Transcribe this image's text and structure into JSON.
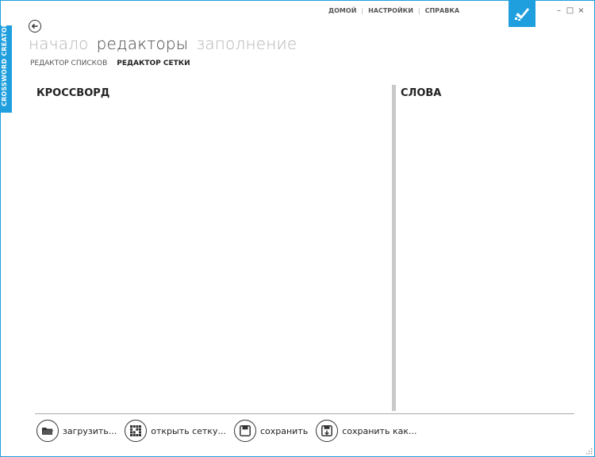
{
  "app": {
    "side_title": "CROSSWORD CREATOR",
    "accent": "#1f9fde"
  },
  "top_links": [
    {
      "label": "ДОМОЙ"
    },
    {
      "label": "НАСТРОЙКИ"
    },
    {
      "label": "СПРАВКА"
    }
  ],
  "window_controls": {
    "minimize": "–",
    "maximize": "□",
    "close": "×"
  },
  "nav": {
    "main": [
      {
        "label": "начало",
        "active": false
      },
      {
        "label": "редакторы",
        "active": true
      },
      {
        "label": "заполнение",
        "active": false
      }
    ],
    "sub": [
      {
        "label": "РЕДАКТОР СПИСКОВ",
        "active": false
      },
      {
        "label": "РЕДАКТОР СЕТКИ",
        "active": true
      }
    ]
  },
  "panels": {
    "left_title": "КРОССВОРД",
    "right_title": "СЛОВА"
  },
  "toolbar": [
    {
      "label": "загрузить...",
      "icon": "folder-icon"
    },
    {
      "label": "открыть сетку...",
      "icon": "grid-icon"
    },
    {
      "label": "сохранить",
      "icon": "floppy-icon"
    },
    {
      "label": "сохранить как...",
      "icon": "floppy-save-as-icon"
    }
  ]
}
